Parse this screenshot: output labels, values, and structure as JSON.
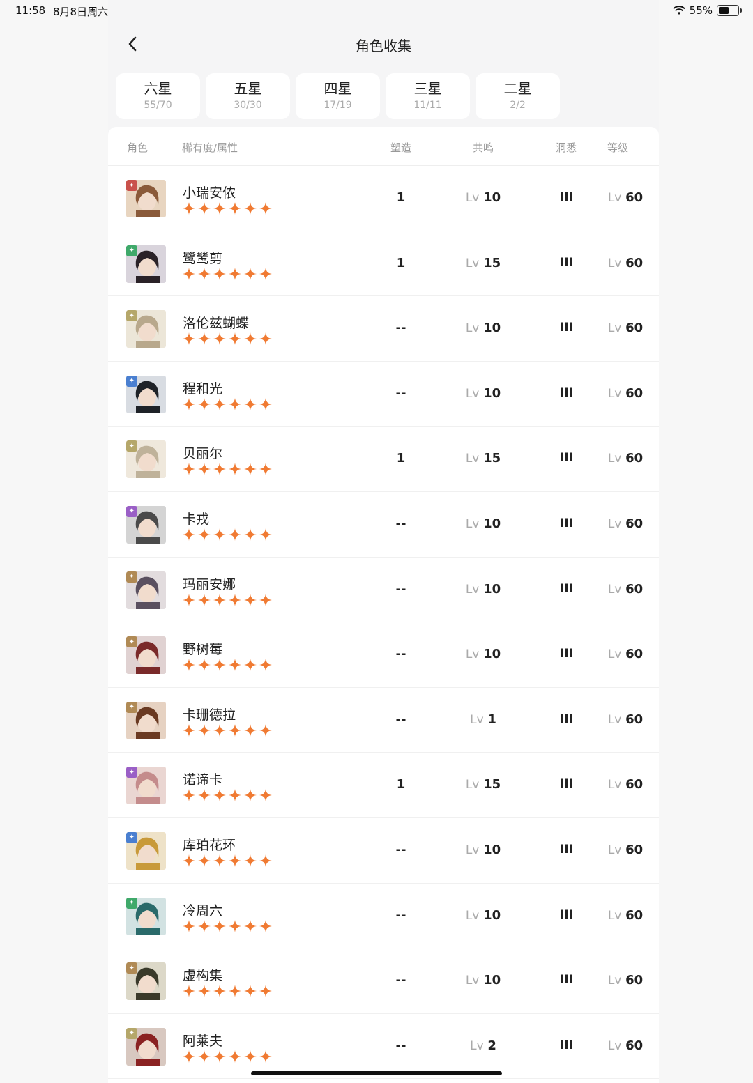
{
  "status": {
    "time": "11:58",
    "date": "8月8日周六",
    "battery": "55%",
    "battery_level": 0.55
  },
  "header": {
    "title": "角色收集",
    "back_icon": "chevron-left-icon"
  },
  "tabs": [
    {
      "label": "六星",
      "count": "55/70"
    },
    {
      "label": "五星",
      "count": "30/30"
    },
    {
      "label": "四星",
      "count": "17/19"
    },
    {
      "label": "三星",
      "count": "11/11"
    },
    {
      "label": "二星",
      "count": "2/2"
    }
  ],
  "table": {
    "headers": {
      "character": "角色",
      "rarity": "稀有度/属性",
      "shaping": "塑造",
      "resonance": "共鸣",
      "insight": "洞悉",
      "level": "等级"
    },
    "lv_prefix": "Lv",
    "rows": [
      {
        "name": "小瑞安侬",
        "stars": 6,
        "shaping": "1",
        "resonance": "10",
        "insight": "III",
        "level": "60",
        "attr_color": "#c9514b",
        "attr_icon": "beast-icon"
      },
      {
        "name": "鹭鸶剪",
        "stars": 6,
        "shaping": "1",
        "resonance": "15",
        "insight": "III",
        "level": "60",
        "attr_color": "#3fa96a",
        "attr_icon": "plant-icon"
      },
      {
        "name": "洛伦兹蝴蝶",
        "stars": 6,
        "shaping": "--",
        "resonance": "10",
        "insight": "III",
        "level": "60",
        "attr_color": "#b5a76a",
        "attr_icon": "mineral-icon"
      },
      {
        "name": "程和光",
        "stars": 6,
        "shaping": "--",
        "resonance": "10",
        "insight": "III",
        "level": "60",
        "attr_color": "#4a7fd0",
        "attr_icon": "star-icon"
      },
      {
        "name": "贝丽尔",
        "stars": 6,
        "shaping": "1",
        "resonance": "15",
        "insight": "III",
        "level": "60",
        "attr_color": "#b5a76a",
        "attr_icon": "mineral-icon"
      },
      {
        "name": "卡戎",
        "stars": 6,
        "shaping": "--",
        "resonance": "10",
        "insight": "III",
        "level": "60",
        "attr_color": "#9a5fc6",
        "attr_icon": "spirit-icon"
      },
      {
        "name": "玛丽安娜",
        "stars": 6,
        "shaping": "--",
        "resonance": "10",
        "insight": "III",
        "level": "60",
        "attr_color": "#b08a55",
        "attr_icon": "intellect-icon"
      },
      {
        "name": "野树莓",
        "stars": 6,
        "shaping": "--",
        "resonance": "10",
        "insight": "III",
        "level": "60",
        "attr_color": "#b08a55",
        "attr_icon": "intellect-icon"
      },
      {
        "name": "卡珊德拉",
        "stars": 6,
        "shaping": "--",
        "resonance": "1",
        "insight": "III",
        "level": "60",
        "attr_color": "#b08a55",
        "attr_icon": "intellect-icon"
      },
      {
        "name": "诺谛卡",
        "stars": 6,
        "shaping": "1",
        "resonance": "15",
        "insight": "III",
        "level": "60",
        "attr_color": "#9a5fc6",
        "attr_icon": "spirit-icon"
      },
      {
        "name": "库珀花环",
        "stars": 6,
        "shaping": "--",
        "resonance": "10",
        "insight": "III",
        "level": "60",
        "attr_color": "#4a7fd0",
        "attr_icon": "star-icon"
      },
      {
        "name": "冷周六",
        "stars": 6,
        "shaping": "--",
        "resonance": "10",
        "insight": "III",
        "level": "60",
        "attr_color": "#3fa96a",
        "attr_icon": "plant-icon"
      },
      {
        "name": "虚构集",
        "stars": 6,
        "shaping": "--",
        "resonance": "10",
        "insight": "III",
        "level": "60",
        "attr_color": "#b08a55",
        "attr_icon": "intellect-icon"
      },
      {
        "name": "阿莱夫",
        "stars": 6,
        "shaping": "--",
        "resonance": "2",
        "insight": "III",
        "level": "60",
        "attr_color": "#b5a76a",
        "attr_icon": "mineral-icon"
      }
    ]
  },
  "colors": {
    "star": "#f07a32",
    "accent_text": "#222222",
    "muted": "#aaaaaa"
  }
}
